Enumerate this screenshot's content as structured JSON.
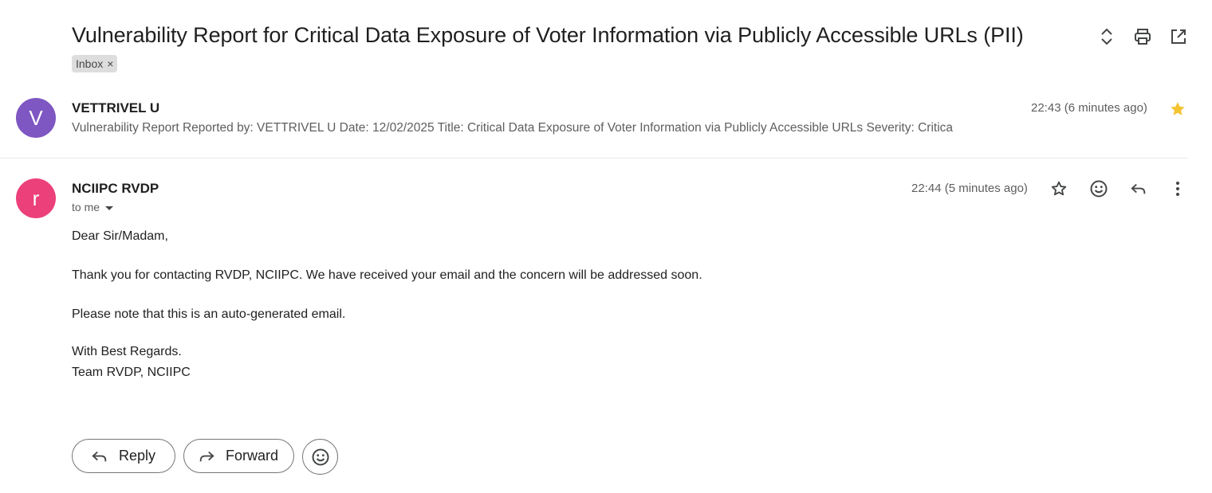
{
  "thread": {
    "subject": "Vulnerability Report for Critical Data Exposure of Voter Information via Publicly Accessible URLs (PII)",
    "label": "Inbox",
    "label_remove": "×"
  },
  "header_icons": [
    "expand-collapse-icon",
    "print-icon",
    "open-in-new-window-icon"
  ],
  "message1": {
    "avatar_letter": "V",
    "avatar_color": "#7e57c2",
    "sender": "VETTRIVEL U",
    "time": "22:43 (6 minutes ago)",
    "snippet": "Vulnerability Report Reported by: VETTRIVEL U Date: 12/02/2025 Title: Critical Data Exposure of Voter Information via Publicly Accessible URLs Severity: Critica",
    "starred": true,
    "star_color": "#f4c430"
  },
  "message2": {
    "avatar_letter": "r",
    "avatar_color": "#ec407a",
    "sender": "NCIIPC RVDP",
    "time": "22:44 (5 minutes ago)",
    "recipient": "to me",
    "body": [
      "Dear Sir/Madam,",
      "Thank you for contacting RVDP, NCIIPC. We have received your email and the concern will be addressed soon.",
      "Please note that this is an auto-generated email.",
      "With Best Regards.",
      "Team RVDP, NCIIPC"
    ]
  },
  "actions": {
    "reply_label": "Reply",
    "forward_label": "Forward"
  }
}
